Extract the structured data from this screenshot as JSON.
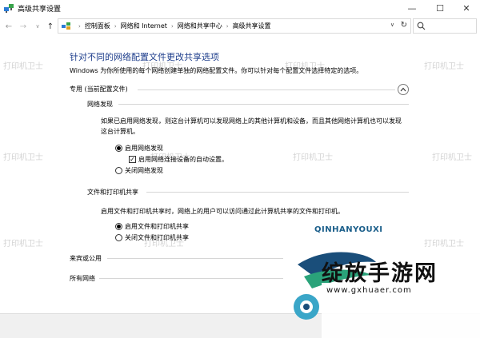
{
  "window": {
    "title": "高级共享设置",
    "minimize": "—",
    "maximize": "☐",
    "close": "✕"
  },
  "nav": {
    "back": "←",
    "forward": "→",
    "recent": "∨",
    "up": "↑",
    "crumbs": [
      "控制面板",
      "网络和 Internet",
      "网络和共享中心",
      "高级共享设置"
    ],
    "separator": "›",
    "dropdown": "∨",
    "refresh": "↻"
  },
  "main": {
    "heading": "针对不同的网络配置文件更改共享选项",
    "subtitle": "Windows 为你所使用的每个网络创建单独的网络配置文件。你可以针对每个配置文件选择特定的选项。",
    "private_profile": {
      "label": "专用 (当前配置文件)",
      "network_discovery": {
        "title": "网络发现",
        "description": "如果已启用网络发现，则这台计算机可以发现网络上的其他计算机和设备，而且其他网络计算机也可以发现这台计算机。",
        "enable": "启用网络发现",
        "auto_setup": "启用网络连接设备的自动设置。",
        "disable": "关闭网络发现"
      },
      "file_printer": {
        "title": "文件和打印机共享",
        "description": "启用文件和打印机共享时，网络上的用户可以访问通过此计算机共享的文件和打印机。",
        "enable": "启用文件和打印机共享",
        "disable": "关闭文件和打印机共享"
      }
    },
    "guest_public": {
      "label": "来宾或公用"
    },
    "all_networks": {
      "label": "所有网络"
    }
  },
  "watermark": "打印机卫士",
  "overlay_logo": {
    "brand": "QINHANYOUXI",
    "name": "绽放手游网",
    "url": "www.gxhuaer.com"
  },
  "colors": {
    "heading": "#1e3e8c",
    "accent": "#0078d4"
  }
}
